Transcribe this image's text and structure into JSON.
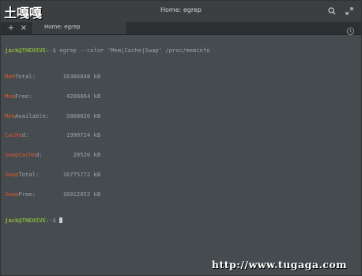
{
  "watermarks": {
    "top": "土嘎嘎",
    "bottom": "http://www.tugaga.com"
  },
  "window": {
    "title": "Home: egrep"
  },
  "tabs": [
    {
      "label": "Home: egrep",
      "active": true
    }
  ],
  "terminal": {
    "command_line": {
      "user_host": "jack@THEHIVE",
      "sep": ":",
      "path": "~",
      "prompt": "$ ",
      "command": "egrep --color 'Mem|Cache|Swap' /proc/meminfo"
    },
    "rows": [
      {
        "key": "Mem",
        "rest": "Total:",
        "value": "16366048 kB"
      },
      {
        "key": "Mem",
        "rest": "Free:",
        "value": "4268064 kB"
      },
      {
        "key": "Mem",
        "rest": "Available:",
        "value": "5808020 kB"
      },
      {
        "key": "Cache",
        "rest": "d:",
        "value": "1998724 kB"
      },
      {
        "key": "SwapCache",
        "rest": "d:",
        "value": "28520 kB"
      },
      {
        "key": "Swap",
        "rest": "Total:",
        "value": "16775772 kB"
      },
      {
        "key": "Swap",
        "rest": "Free:",
        "value": "16012052 kB"
      }
    ],
    "final_prompt": {
      "user_host": "jack@THEHIVE",
      "sep": ":",
      "path": "~",
      "prompt": "$ "
    }
  },
  "colors": {
    "background": "#464b4f",
    "user": "#8ab33f",
    "path": "#5d8fc6",
    "highlight": "#d9592c",
    "text": "#9ea3a6"
  },
  "icons": {
    "search": "search-icon",
    "maximize": "maximize-icon",
    "new_tab": "plus-icon",
    "close_tab": "close-icon",
    "history": "history-icon"
  }
}
